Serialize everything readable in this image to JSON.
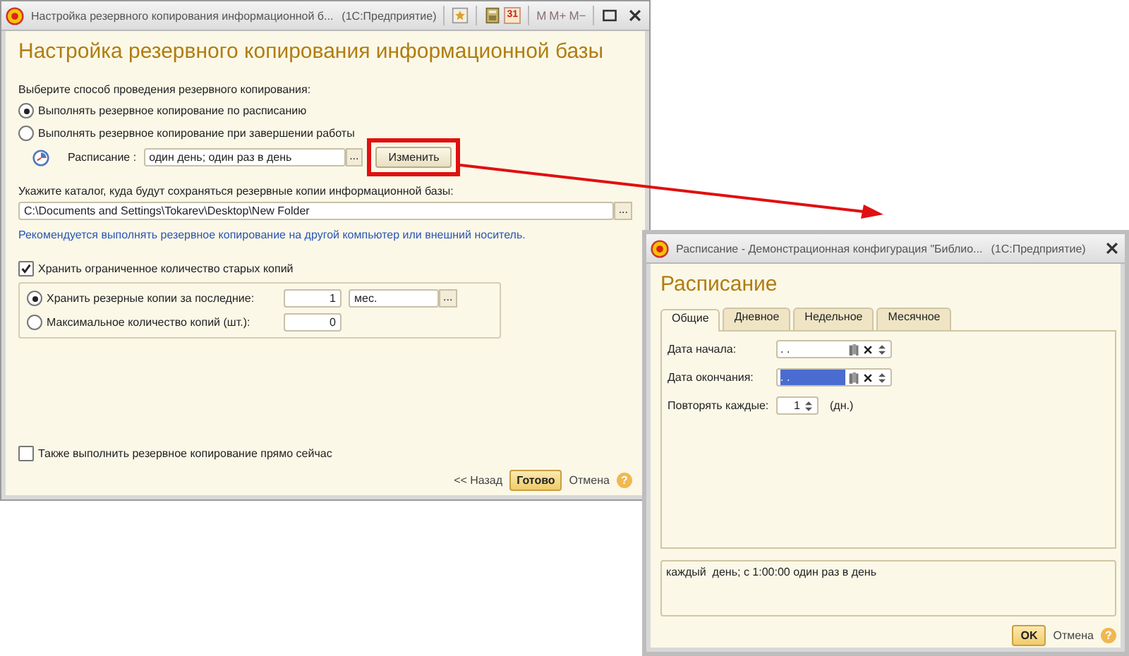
{
  "main_window": {
    "title": "Настройка резервного копирования информационной б...",
    "app": "(1С:Предприятие)",
    "memory_buttons": [
      {
        "label": "M",
        "disabled": true
      },
      {
        "label": "M+",
        "disabled": true
      },
      {
        "label": "M−",
        "disabled": true
      }
    ],
    "calendar_day": "31",
    "heading": "Настройка резервного копирования информационной базы",
    "method_label": "Выберите способ проведения резервного копирования:",
    "methods": [
      {
        "label": "Выполнять резервное копирование по расписанию",
        "selected": true
      },
      {
        "label": "Выполнять резервное копирование при завершении работы",
        "selected": false
      }
    ],
    "schedule": {
      "label": "Расписание :",
      "value": "один день; один раз в день",
      "select_button": "...",
      "button": "Изменить",
      "highlighted": true
    },
    "dir_label": "Укажите каталог, куда будут сохраняться резервные копии информационной базы:",
    "dir_value": "C:\\Documents and Settings\\Tokarev\\Desktop\\New Folder",
    "dir_browse_button": "...",
    "hint": "Рекомендуется выполнять резервное копирование на другой компьютер или внешний носитель.",
    "limit": {
      "label": "Хранить ограниченное количество старых копий",
      "checked": true
    },
    "keep_options": [
      {
        "label": "Хранить резерные копии за последние:",
        "selected": true,
        "value": "1",
        "unit": "мес.",
        "unit_button": "..."
      },
      {
        "label": "Максимальное количество копий (шт.):",
        "selected": false,
        "value": "0"
      }
    ],
    "backup_now": {
      "label": "Также выполнить резервное копирование прямо сейчас",
      "checked": false
    },
    "back_button": "<< Назад",
    "done_button": "Готово",
    "cancel_button": "Отмена",
    "help": "?"
  },
  "schedule_window": {
    "title": "Расписание - Демонстрационная конфигурация \"Библио...",
    "app": "(1С:Предприятие)",
    "heading": "Расписание",
    "tabs": [
      {
        "label": "Общие",
        "selected": true
      },
      {
        "label": "Дневное",
        "selected": false
      },
      {
        "label": "Недельное",
        "selected": false
      },
      {
        "label": "Месячное",
        "selected": false
      }
    ],
    "fields": [
      {
        "kind": "date",
        "label": "Дата начала:",
        "value": ". .",
        "selected": false
      },
      {
        "kind": "date",
        "label": "Дата окончания:",
        "value": ". .",
        "selected": true
      },
      {
        "kind": "number",
        "label": "Повторять каждые:",
        "value": "1",
        "unit": "(дн.)"
      }
    ],
    "summary": "каждый  день; с 1:00:00 один раз в день",
    "ok_button": "OK",
    "cancel_button": "Отмена",
    "help": "?"
  }
}
